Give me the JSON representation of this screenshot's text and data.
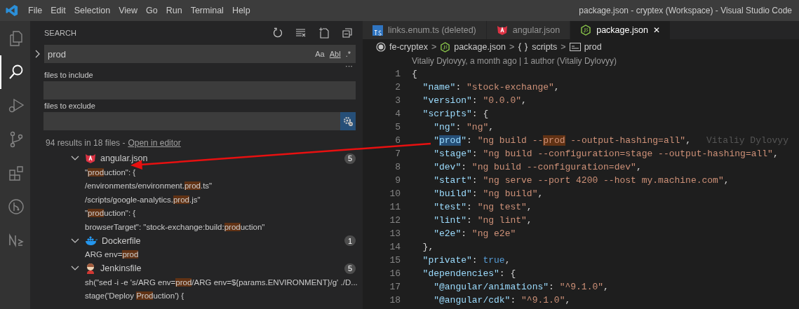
{
  "window": {
    "title": "package.json - cryptex (Workspace) - Visual Studio Code"
  },
  "menu": [
    "File",
    "Edit",
    "Selection",
    "View",
    "Go",
    "Run",
    "Terminal",
    "Help"
  ],
  "activity_bar": [
    {
      "kind": "files",
      "selected": false
    },
    {
      "kind": "search",
      "selected": true
    },
    {
      "kind": "debug",
      "selected": false
    },
    {
      "kind": "branch",
      "selected": false
    },
    {
      "kind": "extensions",
      "selected": false
    },
    {
      "kind": "graph",
      "selected": false
    },
    {
      "kind": "logo",
      "selected": false
    }
  ],
  "search": {
    "title": "SEARCH",
    "query": "prod",
    "options": [
      "Aa",
      "Abl",
      ".*"
    ],
    "more": "···",
    "include_label": "files to include",
    "exclude_label": "files to exclude",
    "use_exclude_settings": true,
    "summary": "94 results in 18 files - ",
    "open_in_editor": "Open in editor"
  },
  "results": [
    {
      "file": "angular.json",
      "kind": "angular",
      "count": "5",
      "expanded": true,
      "matches": [
        [
          {
            "t": "\""
          },
          {
            "t": "prod",
            "m": true
          },
          {
            "t": "uction\": {"
          }
        ],
        [
          {
            "t": "/environments/environment."
          },
          {
            "t": "prod",
            "m": true
          },
          {
            "t": ".ts\""
          }
        ],
        [
          {
            "t": "/scripts/google-analytics."
          },
          {
            "t": "prod",
            "m": true
          },
          {
            "t": ".js\""
          }
        ],
        [
          {
            "t": "\""
          },
          {
            "t": "prod",
            "m": true
          },
          {
            "t": "uction\": {"
          }
        ],
        [
          {
            "t": "browserTarget\": \"stock-exchange:build:"
          },
          {
            "t": "prod",
            "m": true
          },
          {
            "t": "uction\""
          }
        ]
      ]
    },
    {
      "file": "Dockerfile",
      "kind": "docker",
      "count": "1",
      "expanded": true,
      "matches": [
        [
          {
            "t": "ARG env="
          },
          {
            "t": "prod",
            "m": true
          }
        ]
      ]
    },
    {
      "file": "Jenkinsfile",
      "kind": "jenkins",
      "count": "5",
      "expanded": true,
      "matches": [
        [
          {
            "t": "sh(\"sed -i -e 's/ARG env="
          },
          {
            "t": "prod",
            "m": true
          },
          {
            "t": "/ARG env=${params.ENVIRONMENT}/g' ./D..."
          }
        ],
        [
          {
            "t": "stage('Deploy "
          },
          {
            "t": "Prod",
            "m": true
          },
          {
            "t": "uction') {"
          }
        ]
      ]
    }
  ],
  "tabs": [
    {
      "label": "links.enum.ts (deleted)",
      "kind": "ts",
      "selected": false,
      "closable": false
    },
    {
      "label": "angular.json",
      "kind": "angular",
      "selected": false,
      "closable": false
    },
    {
      "label": "package.json",
      "kind": "node",
      "selected": true,
      "closable": true
    }
  ],
  "close_glyph": "✕",
  "breadcrumbs": [
    {
      "label": "fe-cryptex",
      "kind": "folder"
    },
    {
      "label": "package.json",
      "kind": "node"
    },
    {
      "label": "scripts",
      "kind": "object"
    },
    {
      "label": "prod",
      "kind": "string"
    }
  ],
  "breadcrumb_separator": ">",
  "blame": "Vitaliy Dylovyy, a month ago | 1 author (Vitaliy Dylovyy)",
  "code": [
    {
      "n": "1",
      "tokens": [
        {
          "t": "{",
          "kind": "p"
        }
      ]
    },
    {
      "n": "2",
      "tokens": [
        {
          "t": "  \"name\"",
          "kind": "key"
        },
        {
          "t": ": ",
          "kind": "p"
        },
        {
          "t": "\"stock-exchange\"",
          "kind": "str"
        },
        {
          "t": ",",
          "kind": "p"
        }
      ]
    },
    {
      "n": "3",
      "tokens": [
        {
          "t": "  \"version\"",
          "kind": "key"
        },
        {
          "t": ": ",
          "kind": "p"
        },
        {
          "t": "\"0.0.0\"",
          "kind": "str"
        },
        {
          "t": ",",
          "kind": "p"
        }
      ]
    },
    {
      "n": "4",
      "tokens": [
        {
          "t": "  \"scripts\"",
          "kind": "key"
        },
        {
          "t": ": {",
          "kind": "p"
        }
      ]
    },
    {
      "n": "5",
      "tokens": [
        {
          "t": "    \"ng\"",
          "kind": "key"
        },
        {
          "t": ": ",
          "kind": "p"
        },
        {
          "t": "\"ng\"",
          "kind": "str"
        },
        {
          "t": ",",
          "kind": "p"
        }
      ]
    },
    {
      "n": "6",
      "blame": "Vitaliy Dylovyy",
      "tokens": [
        {
          "t": "    \"",
          "kind": "key"
        },
        {
          "t": "prod",
          "kind": "key",
          "sel": true
        },
        {
          "t": "\"",
          "kind": "key"
        },
        {
          "t": ": ",
          "kind": "p"
        },
        {
          "t": "\"ng build --",
          "kind": "str"
        },
        {
          "t": "prod",
          "kind": "str",
          "m": true
        },
        {
          "t": " --output-hashing=all\"",
          "kind": "str"
        },
        {
          "t": ",",
          "kind": "p"
        }
      ]
    },
    {
      "n": "7",
      "tokens": [
        {
          "t": "    \"stage\"",
          "kind": "key"
        },
        {
          "t": ": ",
          "kind": "p"
        },
        {
          "t": "\"ng build --configuration=stage --output-hashing=all\"",
          "kind": "str"
        },
        {
          "t": ",",
          "kind": "p"
        }
      ]
    },
    {
      "n": "8",
      "tokens": [
        {
          "t": "    \"dev\"",
          "kind": "key"
        },
        {
          "t": ": ",
          "kind": "p"
        },
        {
          "t": "\"ng build --configuration=dev\"",
          "kind": "str"
        },
        {
          "t": ",",
          "kind": "p"
        }
      ]
    },
    {
      "n": "9",
      "tokens": [
        {
          "t": "    \"start\"",
          "kind": "key"
        },
        {
          "t": ": ",
          "kind": "p"
        },
        {
          "t": "\"ng serve --port 4200 --host my.machine.com\"",
          "kind": "str"
        },
        {
          "t": ",",
          "kind": "p"
        }
      ]
    },
    {
      "n": "10",
      "tokens": [
        {
          "t": "    \"build\"",
          "kind": "key"
        },
        {
          "t": ": ",
          "kind": "p"
        },
        {
          "t": "\"ng build\"",
          "kind": "str"
        },
        {
          "t": ",",
          "kind": "p"
        }
      ]
    },
    {
      "n": "11",
      "tokens": [
        {
          "t": "    \"test\"",
          "kind": "key"
        },
        {
          "t": ": ",
          "kind": "p"
        },
        {
          "t": "\"ng test\"",
          "kind": "str"
        },
        {
          "t": ",",
          "kind": "p"
        }
      ]
    },
    {
      "n": "12",
      "tokens": [
        {
          "t": "    \"lint\"",
          "kind": "key"
        },
        {
          "t": ": ",
          "kind": "p"
        },
        {
          "t": "\"ng lint\"",
          "kind": "str"
        },
        {
          "t": ",",
          "kind": "p"
        }
      ]
    },
    {
      "n": "13",
      "tokens": [
        {
          "t": "    \"e2e\"",
          "kind": "key"
        },
        {
          "t": ": ",
          "kind": "p"
        },
        {
          "t": "\"ng e2e\"",
          "kind": "str"
        }
      ]
    },
    {
      "n": "14",
      "tokens": [
        {
          "t": "  },",
          "kind": "p"
        }
      ]
    },
    {
      "n": "15",
      "tokens": [
        {
          "t": "  \"private\"",
          "kind": "key"
        },
        {
          "t": ": ",
          "kind": "p"
        },
        {
          "t": "true",
          "kind": "bool"
        },
        {
          "t": ",",
          "kind": "p"
        }
      ]
    },
    {
      "n": "16",
      "tokens": [
        {
          "t": "  \"dependencies\"",
          "kind": "key"
        },
        {
          "t": ": {",
          "kind": "p"
        }
      ]
    },
    {
      "n": "17",
      "tokens": [
        {
          "t": "    \"@angular/animations\"",
          "kind": "key"
        },
        {
          "t": ": ",
          "kind": "p"
        },
        {
          "t": "\"^9.1.0\"",
          "kind": "str"
        },
        {
          "t": ",",
          "kind": "p"
        }
      ]
    },
    {
      "n": "18",
      "tokens": [
        {
          "t": "    \"@angular/cdk\"",
          "kind": "key"
        },
        {
          "t": ": ",
          "kind": "p"
        },
        {
          "t": "\"^9.1.0\"",
          "kind": "str"
        },
        {
          "t": ",",
          "kind": "p"
        }
      ]
    }
  ]
}
